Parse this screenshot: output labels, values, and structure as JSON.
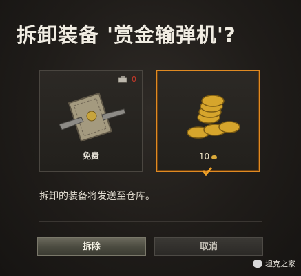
{
  "dialog": {
    "title": "拆卸装备 '赏金输弹机'?",
    "message": "拆卸的装备将发送至仓库。"
  },
  "options": {
    "free": {
      "label": "免费",
      "toolkit_count": "0",
      "icon": "wrench-ticket-icon"
    },
    "gold": {
      "price": "10",
      "currency_icon": "gold-coin-icon",
      "icon": "gold-coins-icon",
      "selected": true
    }
  },
  "buttons": {
    "confirm": "拆除",
    "cancel": "取消"
  },
  "watermark": {
    "text": "坦克之家"
  },
  "colors": {
    "accent": "#e08a22",
    "count_red": "#d23a2a",
    "gold": "#d9a93a"
  }
}
